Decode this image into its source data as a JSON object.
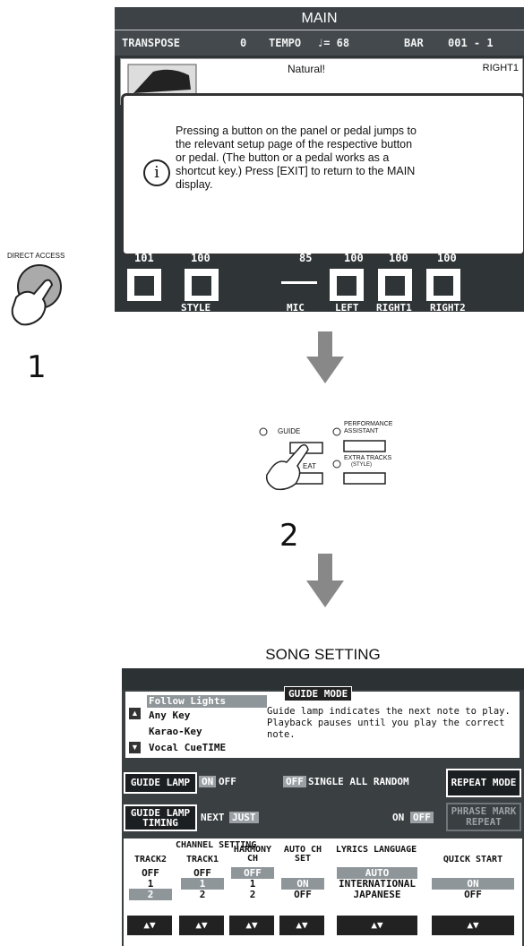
{
  "main_screen": {
    "title": "MAIN",
    "transpose_label": "TRANSPOSE",
    "transpose_value": "0",
    "tempo_label": "TEMPO",
    "tempo_value": "♩= 68",
    "bar_label": "BAR",
    "bar_value": "001 - 1",
    "voice_name": "Natural!",
    "voice_part": "RIGHT1",
    "dialog_message": "Pressing a button on the panel or pedal jumps to the relevant setup page of the respective button or pedal. (The button or a pedal works as a shortcut key.) Press [EXIT] to return to the MAIN display.",
    "mixer_values": [
      "101",
      "100",
      "85",
      "100",
      "100",
      "100"
    ],
    "mixer_labels": [
      "STYLE",
      "MIC",
      "LEFT",
      "RIGHT1",
      "RIGHT2"
    ]
  },
  "panel": {
    "direct_access_label": "DIRECT ACCESS",
    "step1": "1",
    "guide_label": "GUIDE",
    "performance_assistant_label": "PERFORMANCE ASSISTANT",
    "repeat_label": "EAT",
    "extra_tracks_label": "EXTRA TRACKS",
    "extra_tracks_sub": "(STYLE)",
    "step2": "2"
  },
  "song_setting": {
    "title": "SONG SETTING",
    "modes": [
      "Follow Lights",
      "Any Key",
      "Karao-Key",
      "Vocal CueTIME"
    ],
    "guide_mode_tab": "GUIDE MODE",
    "guide_mode_desc": "Guide lamp indicates the next note to play. Playback pauses until you play the correct note.",
    "guide_lamp_label": "GUIDE LAMP",
    "guide_lamp_on": "ON",
    "guide_lamp_off": "OFF",
    "repeat_off": "OFF",
    "repeat_options": "SINGLE ALL RANDOM",
    "repeat_mode_button": "REPEAT MODE",
    "guide_lamp_timing": "GUIDE LAMP TIMING",
    "timing_next": "NEXT",
    "timing_just": "JUST",
    "phrase_on": "ON",
    "phrase_off": "OFF",
    "phrase_mark_repeat": "PHRASE MARK REPEAT",
    "channel_setting": "CHANNEL SETTING",
    "col_track2": "TRACK2",
    "col_track1": "TRACK1",
    "col_harmony": "HARMONY CH",
    "col_auto": "AUTO CH SET",
    "col_lyrics": "LYRICS LANGUAGE",
    "col_quick": "QUICK START",
    "track2_values": [
      "OFF",
      "1",
      "2"
    ],
    "track1_values": [
      "OFF",
      "1",
      "2"
    ],
    "harmony_values": [
      "OFF",
      "1",
      "2"
    ],
    "auto_values": [
      "ON",
      "OFF"
    ],
    "lyrics_values": [
      "AUTO",
      "INTERNATIONAL",
      "JAPANESE"
    ],
    "quick_values": [
      "ON",
      "OFF"
    ],
    "updown": "▲▼"
  }
}
